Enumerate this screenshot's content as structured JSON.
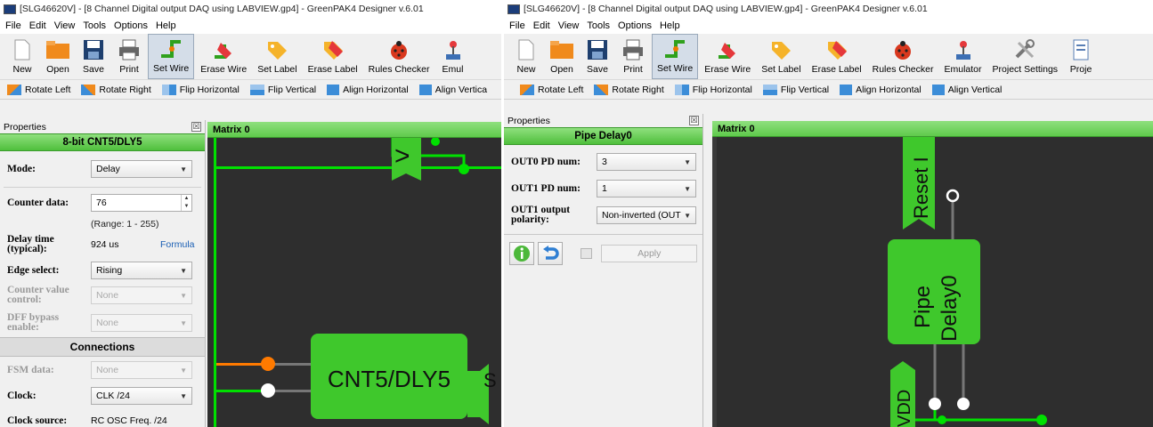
{
  "left": {
    "title": "[SLG46620V] - [8 Channel Digital output DAQ using LABVIEW.gp4] - GreenPAK4 Designer v.6.01",
    "menu": [
      "File",
      "Edit",
      "View",
      "Tools",
      "Options",
      "Help"
    ],
    "toolbar": [
      "New",
      "Open",
      "Save",
      "Print",
      "Set Wire",
      "Erase Wire",
      "Set Label",
      "Erase Label",
      "Rules Checker",
      "Emul"
    ],
    "toolbar2": [
      "Rotate Left",
      "Rotate Right",
      "Flip Horizontal",
      "Flip Vertical",
      "Align Horizontal",
      "Align Vertica"
    ],
    "properties": {
      "header": "Properties",
      "close": "☒",
      "block_title": "8-bit CNT5/DLY5",
      "mode_label": "Mode:",
      "mode_value": "Delay",
      "counter_label": "Counter data:",
      "counter_value": "76",
      "counter_range": "(Range:  1 - 255)",
      "delay_label_1": "Delay time",
      "delay_label_2": "(typical):",
      "delay_value": "924 us",
      "formula_link": "Formula",
      "edge_label": "Edge select:",
      "edge_value": "Rising",
      "cvc_label_1": "Counter value",
      "cvc_label_2": "control:",
      "cvc_value": "None",
      "dff_label_1": "DFF bypass",
      "dff_label_2": "enable:",
      "dff_value": "None",
      "connections_title": "Connections",
      "fsm_label": "FSM data:",
      "fsm_value": "None",
      "clock_label": "Clock:",
      "clock_value": "CLK /24",
      "clock_source_label": "Clock source:",
      "clock_source_value": "RC OSC Freq. /24"
    },
    "matrix": {
      "title": "Matrix 0",
      "block_label": "CNT5/DLY5",
      "gate_symbol": ">",
      "out_label": "S"
    }
  },
  "right": {
    "title": "[SLG46620V] - [8 Channel Digital output DAQ using LABVIEW.gp4] - GreenPAK4 Designer v.6.01",
    "menu": [
      "File",
      "Edit",
      "View",
      "Tools",
      "Options",
      "Help"
    ],
    "toolbar": [
      "New",
      "Open",
      "Save",
      "Print",
      "Set Wire",
      "Erase Wire",
      "Set Label",
      "Erase Label",
      "Rules Checker",
      "Emulator",
      "Project Settings",
      "Proje"
    ],
    "toolbar2": [
      "Rotate Left",
      "Rotate Right",
      "Flip Horizontal",
      "Flip Vertical",
      "Align Horizontal",
      "Align Vertical"
    ],
    "properties": {
      "header": "Properties",
      "close": "☒",
      "block_title": "Pipe Delay0",
      "out0_label": "OUT0 PD num:",
      "out0_value": "3",
      "out1_label": "OUT1 PD num:",
      "out1_value": "1",
      "pol_label_1": "OUT1 output",
      "pol_label_2": "polarity:",
      "pol_value": "Non-inverted (OUT",
      "apply": "Apply"
    },
    "matrix": {
      "title": "Matrix 0",
      "block_line1": "Pipe",
      "block_line2": "Delay0",
      "reset_label": "Reset I",
      "vdd_label": "VDD"
    }
  },
  "colors": {
    "accent_green": "#4fbf3c",
    "block_green": "#3fc82c",
    "wire_green": "#00e000",
    "wire_orange": "#ff7a00",
    "matrix_bg": "#2e2e2e"
  }
}
